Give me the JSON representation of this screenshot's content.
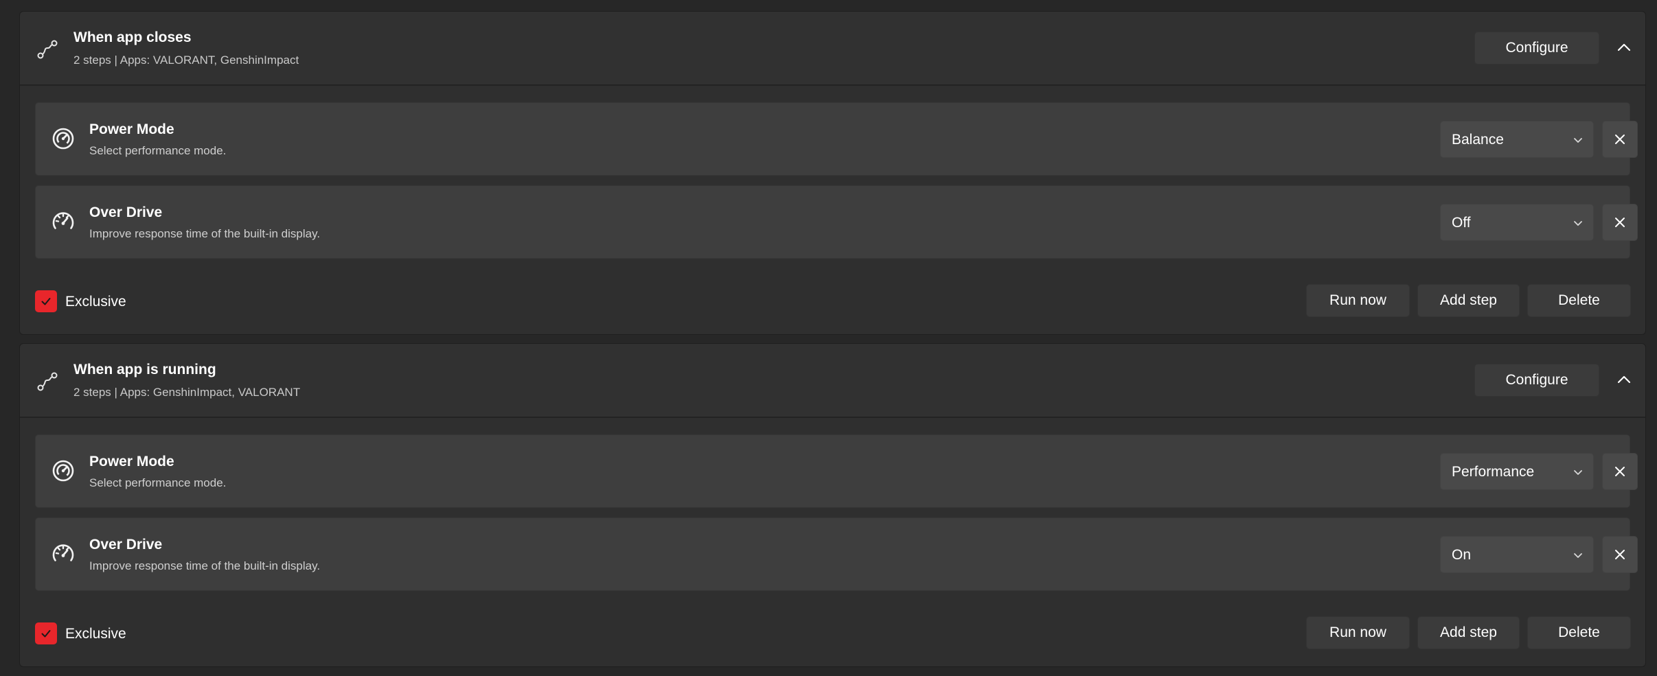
{
  "colors": {
    "accent": "#e8262b",
    "card": "#2f2f2f",
    "step": "#3e3e3e",
    "background": "#272727"
  },
  "automations": [
    {
      "title": "When app closes",
      "subtitle": "2 steps | Apps: VALORANT, GenshinImpact",
      "configure_label": "Configure",
      "collapse_icon": "chevron-up-icon",
      "header_icon": "route-icon",
      "steps": [
        {
          "icon": "gauge-icon",
          "title": "Power Mode",
          "description": "Select performance mode.",
          "value": "Balance"
        },
        {
          "icon": "speedometer-icon",
          "title": "Over Drive",
          "description": "Improve response time of the built-in display.",
          "value": "Off"
        }
      ],
      "exclusive": {
        "label": "Exclusive",
        "checked": true
      },
      "actions": {
        "run_now": "Run now",
        "add_step": "Add step",
        "delete": "Delete"
      }
    },
    {
      "title": "When app is running",
      "subtitle": "2 steps | Apps: GenshinImpact, VALORANT",
      "configure_label": "Configure",
      "collapse_icon": "chevron-up-icon",
      "header_icon": "route-icon",
      "steps": [
        {
          "icon": "gauge-icon",
          "title": "Power Mode",
          "description": "Select performance mode.",
          "value": "Performance"
        },
        {
          "icon": "speedometer-icon",
          "title": "Over Drive",
          "description": "Improve response time of the built-in display.",
          "value": "On"
        }
      ],
      "exclusive": {
        "label": "Exclusive",
        "checked": true
      },
      "actions": {
        "run_now": "Run now",
        "add_step": "Add step",
        "delete": "Delete"
      }
    }
  ]
}
